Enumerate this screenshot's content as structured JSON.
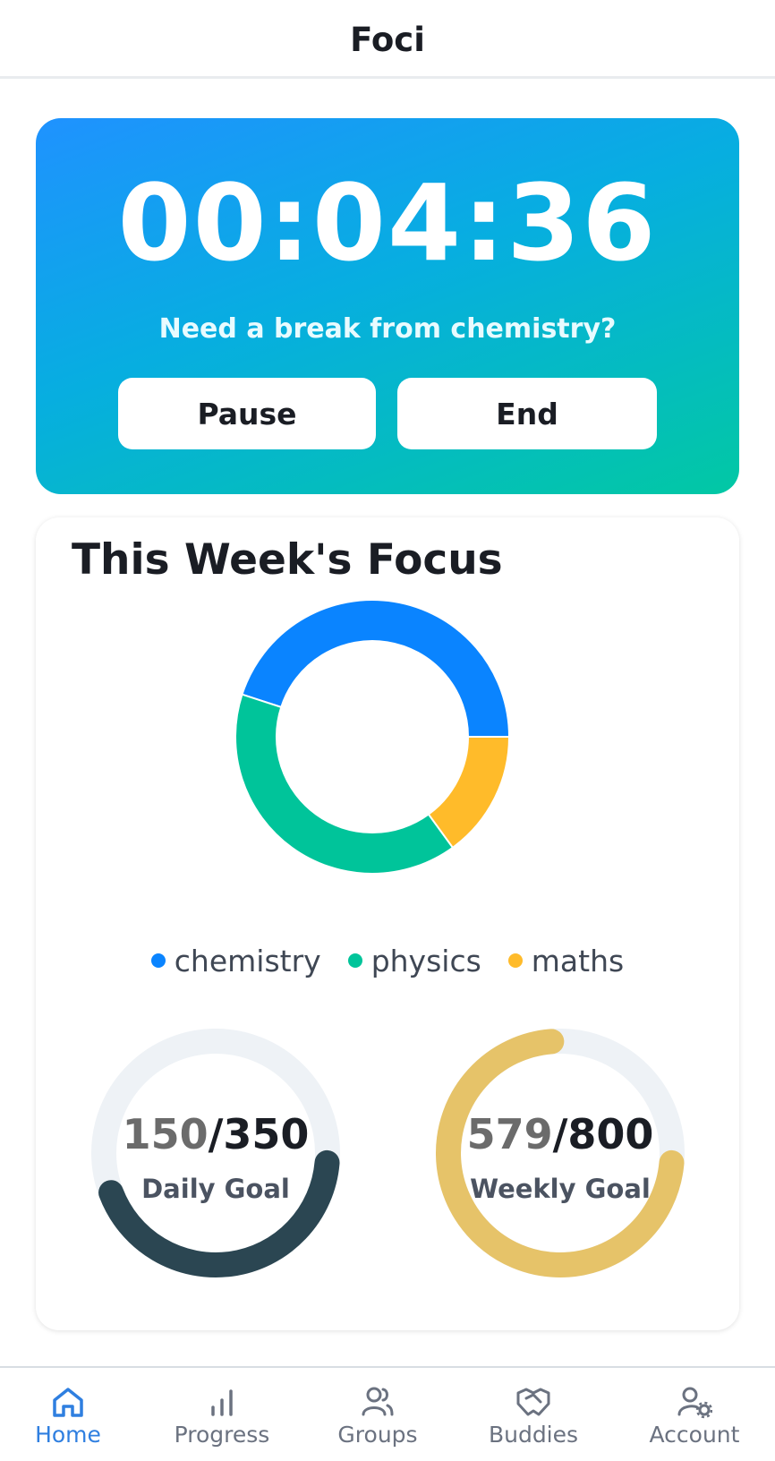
{
  "header": {
    "title": "Foci"
  },
  "timer_card": {
    "time": "00:04:36",
    "prompt": "Need a break from chemistry?",
    "pause_label": "Pause",
    "end_label": "End"
  },
  "focus": {
    "title": "This Week's Focus",
    "legend": [
      {
        "label": "chemistry",
        "color": "#0a84ff"
      },
      {
        "label": "physics",
        "color": "#00c49a"
      },
      {
        "label": "maths",
        "color": "#ffbb2a"
      }
    ]
  },
  "chart_data": {
    "type": "pie",
    "title": "This Week's Focus",
    "categories": [
      "chemistry",
      "physics",
      "maths"
    ],
    "values": [
      45,
      40,
      15
    ],
    "colors": [
      "#0a84ff",
      "#00c49a",
      "#ffbb2a"
    ],
    "legend": "bottom"
  },
  "goals": {
    "daily": {
      "current": "150",
      "total": "/350",
      "label": "Daily Goal",
      "progress": 0.4286,
      "color": "#2b4652"
    },
    "weekly": {
      "current": "579",
      "total": "/800",
      "label": "Weekly Goal",
      "progress": 0.7238,
      "color": "#e6c369"
    }
  },
  "nav": {
    "items": [
      {
        "label": "Home",
        "icon": "home-icon",
        "active": true
      },
      {
        "label": "Progress",
        "icon": "bar-chart-icon",
        "active": false
      },
      {
        "label": "Groups",
        "icon": "users-icon",
        "active": false
      },
      {
        "label": "Buddies",
        "icon": "handshake-icon",
        "active": false
      },
      {
        "label": "Account",
        "icon": "user-settings-icon",
        "active": false
      }
    ],
    "active_color": "#2f7fe0"
  }
}
